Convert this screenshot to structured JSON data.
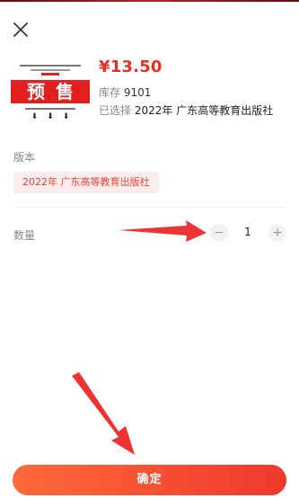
{
  "product": {
    "price": "¥13.50",
    "stock_label": "库存",
    "stock_value": "9101",
    "selected_label": "已选择",
    "selected_value": "2022年 广东高等教育出版社",
    "thumbnail_banner": "预售",
    "thumbnail_arrows": [
      "⬇",
      "⬇",
      "⬇"
    ]
  },
  "spec": {
    "label": "版本",
    "option": "2022年 广东高等教育出版社"
  },
  "quantity": {
    "label": "数量",
    "value": "1",
    "minus": "−",
    "plus": "+"
  },
  "actions": {
    "confirm": "确定"
  },
  "icons": {
    "close": "close-icon"
  },
  "colors": {
    "accent": "#ee2c22",
    "chip_bg": "#fdecec",
    "annotation": "#ee3333"
  }
}
